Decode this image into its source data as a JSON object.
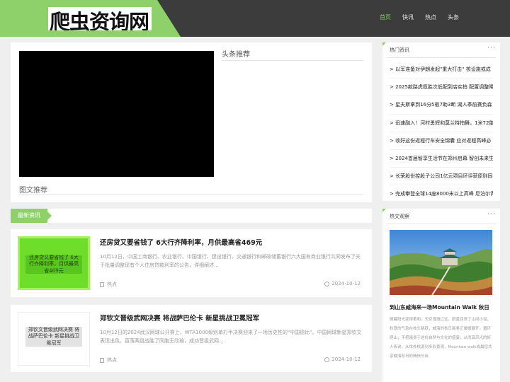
{
  "header": {
    "logo_text": "爬虫资询网",
    "nav": [
      "首页",
      "快讯",
      "热点",
      "头条"
    ]
  },
  "headline": {
    "title": "头条推荐",
    "tuwen_label": "图文推荐"
  },
  "latest": {
    "tab_label": "最新资讯",
    "articles": [
      {
        "title": "还房贷又要省钱了 6大行齐降利率，月供最高省469元",
        "thumb_text": "还房贷又要省钱了 6大行齐降利率，月供最高省469元",
        "desc": "10月12日，中国工商银行、农业银行、中国银行、建设银行、交通银行和邮政储蓄银行六大国有商业银行共同发布了关于批量调整现有个人住房贷款利率的公告，详细阐述...",
        "tag": "热点",
        "date": "2024-10-12"
      },
      {
        "title": "郑钦文晋级武网决赛 将战萨巴伦卡 新星挑战卫冕冠军",
        "thumb_text": "郑钦文晋级武网决赛 将战萨巴伦卡 新星挑战卫冕冠军",
        "desc": "10月12日的2024武汉网球公开赛上，WTA1000级别单打半决赛迎来了一场历史性的\"中国德比\"。中国网球新星郑钦文表现出色，直落两盘战胜了同胞王欣瑜，成功晋级武网...",
        "tag": "热点",
        "date": "2024-10-12"
      }
    ]
  },
  "sidebar": {
    "hot": {
      "title": "热门资讯",
      "more": "···",
      "items": [
        "> 以军准备对伊朗发起\"重大打击\" 核设施或成",
        "> 2025款路虎揽胜次低配到店实拍 配置调整降",
        "> 星夫斯拿到16分5板7助3断 湖人季前赛负森",
        "> 迅速融入！河村勇辉和莫兰特拍舞，1米72能",
        "> 收好这份返程行车安全锦囊 应对返程高峰必",
        "> 2024首届智享生活节在郑州启幕 智创未来生",
        "> 长荣股份控股子公司1亿元项目环评获原则同",
        "> 完成攀登全球14座8000米以上高峰 尼泊尔青"
      ]
    },
    "pic": {
      "title": "热文观察",
      "more": "···",
      "article_title": "到山东威海来一场Mountain Walk 秋日",
      "desc": "随着阳光变得柔和，天空澄澈辽远，蔚蓝润泽了山间小径，秋意的气息在枝头跳跃，威海的秋日画卷正缓缓展开。循环爬山，不把暗身于这份自然与文化的盛宴，从而真风光的好人传说，从世外桃源到多彩景观，Mountain walk成最您共享威海秋日的畅快与自"
    }
  }
}
